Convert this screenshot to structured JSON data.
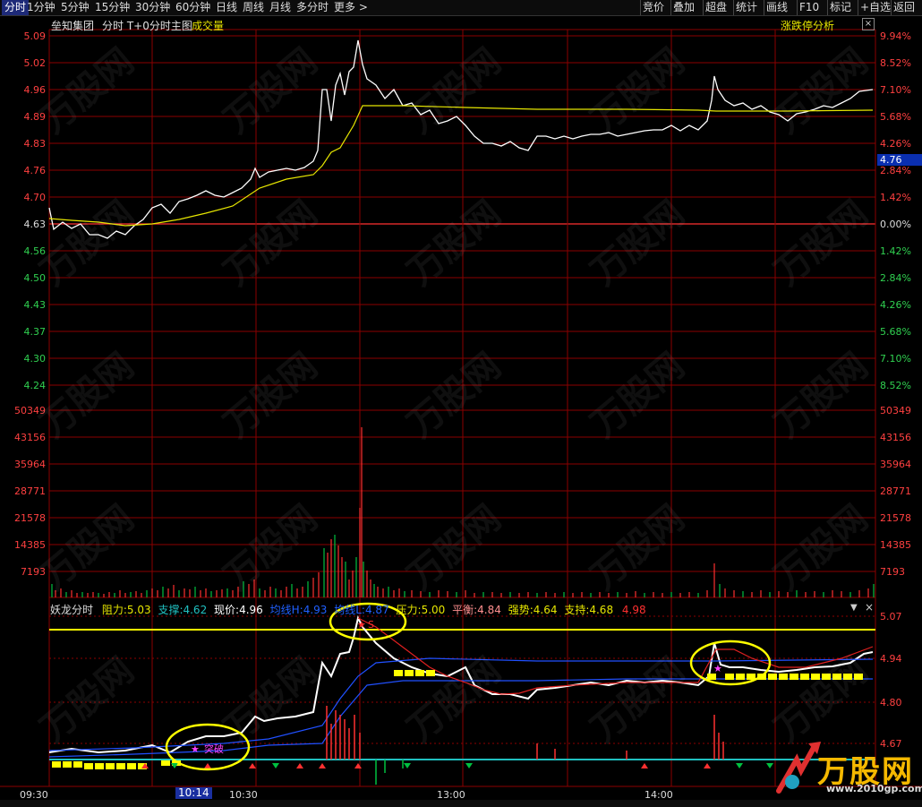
{
  "toolbar": {
    "left_tabs": [
      "分时",
      "1分钟",
      "5分钟",
      "15分钟",
      "30分钟",
      "60分钟",
      "日线",
      "周线",
      "月线",
      "多分时",
      "更多 >"
    ],
    "right_tabs": [
      "竞价",
      "叠加",
      "超盘",
      "统计",
      "画线",
      "F10",
      "标记",
      "+自选",
      "返回"
    ]
  },
  "price_panel": {
    "stock_name": "垒知集团",
    "mode_label": "分时 T+0分时主图",
    "volume_label": "成交量",
    "analysis_label": "涨跌停分析",
    "price_ticks": [
      "5.09",
      "5.02",
      "4.96",
      "4.89",
      "4.83",
      "4.76",
      "4.70",
      "4.63",
      "4.56",
      "4.50",
      "4.43",
      "4.37",
      "4.30",
      "4.24"
    ],
    "pct_ticks": [
      "9.94%",
      "8.52%",
      "7.10%",
      "5.68%",
      "4.26%",
      "2.84%",
      "1.42%",
      "0.00%",
      "1.42%",
      "2.84%",
      "4.26%",
      "5.68%",
      "7.10%",
      "8.52%"
    ],
    "current_price_tag": "4.76",
    "close_icon": "close-icon"
  },
  "volume_panel": {
    "ticks": [
      "50349",
      "43156",
      "35964",
      "28771",
      "21578",
      "14385",
      "7193"
    ]
  },
  "indicator_panel": {
    "name": "妖龙分时",
    "resistance_label": "阻力:",
    "resistance_value": "5.03",
    "support_label": "支撑:",
    "support_value": "4.62",
    "price_label": "现价:",
    "price_value": "4.96",
    "avgH_label": "均线H:",
    "avgH_value": "4.93",
    "avgL_label": "均线L:",
    "avgL_value": "4.87",
    "pressure_label": "压力:",
    "pressure_value": "5.00",
    "balance_label": "平衡:",
    "balance_value": "4.84",
    "strength_label": "强势:",
    "strength_value": "4.64",
    "support2_label": "支持:",
    "support2_value": "4.68",
    "extra_value": "4.98",
    "right_ticks": [
      "5.07",
      "4.94",
      "4.80",
      "4.67"
    ],
    "signal_breakout": "突破",
    "signal_s": "S"
  },
  "time_axis": {
    "labels": [
      "09:30",
      "10:30",
      "13:00",
      "14:00"
    ],
    "cursor_time": "10:14"
  },
  "brand": {
    "name": "万股网",
    "url": "www.2010gp.com"
  },
  "colors": {
    "grid": "#8b0000",
    "price_line": "#ffffff",
    "avg_line": "#e6e600",
    "up": "#ff3030",
    "down": "#00c040",
    "highlight": "#ffff00"
  }
}
